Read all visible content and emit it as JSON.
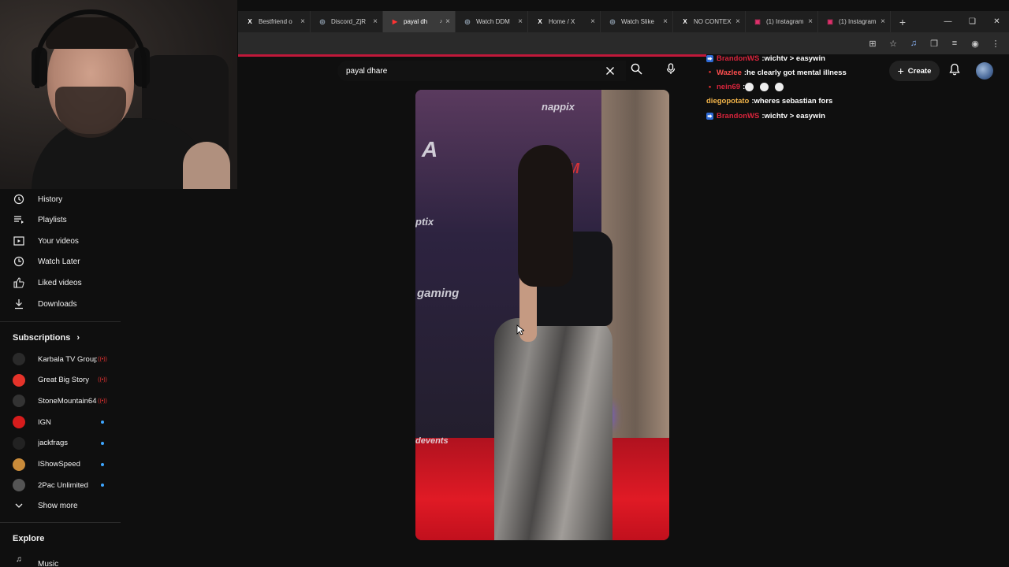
{
  "browser": {
    "tabs": [
      {
        "label": "Bestfriend o",
        "icon": "x-logo-icon"
      },
      {
        "label": "Discord_ZjR",
        "icon": "globe-icon"
      },
      {
        "label": "payal dh",
        "icon": "youtube-icon",
        "active": true
      },
      {
        "label": "Watch DDM",
        "icon": "globe-icon"
      },
      {
        "label": "Home / X",
        "icon": "x-logo-icon"
      },
      {
        "label": "Watch Slike",
        "icon": "globe-icon"
      },
      {
        "label": "NO CONTEX",
        "icon": "x-logo-icon"
      },
      {
        "label": "(1) Instagram",
        "icon": "instagram-icon"
      },
      {
        "label": "(1) Instagram",
        "icon": "instagram-icon"
      }
    ],
    "new_tab": "+"
  },
  "search": {
    "query": "payal dhare"
  },
  "sidebar": {
    "library": [
      {
        "label": "History",
        "icon": "history-icon"
      },
      {
        "label": "Playlists",
        "icon": "playlists-icon"
      },
      {
        "label": "Your videos",
        "icon": "your-videos-icon"
      },
      {
        "label": "Watch Later",
        "icon": "watch-later-icon"
      },
      {
        "label": "Liked videos",
        "icon": "like-icon"
      },
      {
        "label": "Downloads",
        "icon": "download-icon"
      }
    ],
    "subscriptions_title": "Subscriptions",
    "subscriptions": [
      {
        "label": "Karbala TV Group",
        "status": "live",
        "color": "#2a2a2a"
      },
      {
        "label": "Great Big Story",
        "status": "live",
        "color": "#e5332a"
      },
      {
        "label": "StoneMountain64",
        "status": "live",
        "color": "#333333"
      },
      {
        "label": "IGN",
        "status": "new",
        "color": "#d61c1c"
      },
      {
        "label": "jackfrags",
        "status": "new",
        "color": "#222222"
      },
      {
        "label": "IShowSpeed",
        "status": "new",
        "color": "#c98b3a"
      },
      {
        "label": "2Pac Unlimited",
        "status": "new",
        "color": "#555555"
      }
    ],
    "show_more": "Show more",
    "explore_title": "Explore",
    "explore_partial": "Music"
  },
  "chat": [
    {
      "user": "BrandonWS",
      "msg": "wichtv > easywin",
      "color": "#d8243c"
    },
    {
      "user": "Wazlee",
      "msg": "he clearly got mental illness",
      "color": "#ff4f4f"
    },
    {
      "user": "nein69",
      "msg": "",
      "color": "#d8243c"
    },
    {
      "user": "diegopotato",
      "msg": "wheres sebastian fors",
      "color": "#f5b64a"
    },
    {
      "user": "BrandonWS",
      "msg": "wichtv > easywin",
      "color": "#d8243c"
    }
  ],
  "header": {
    "create_label": "Create"
  },
  "colors": {
    "accent_red": "#c0183a",
    "background": "#0f0f0f"
  }
}
